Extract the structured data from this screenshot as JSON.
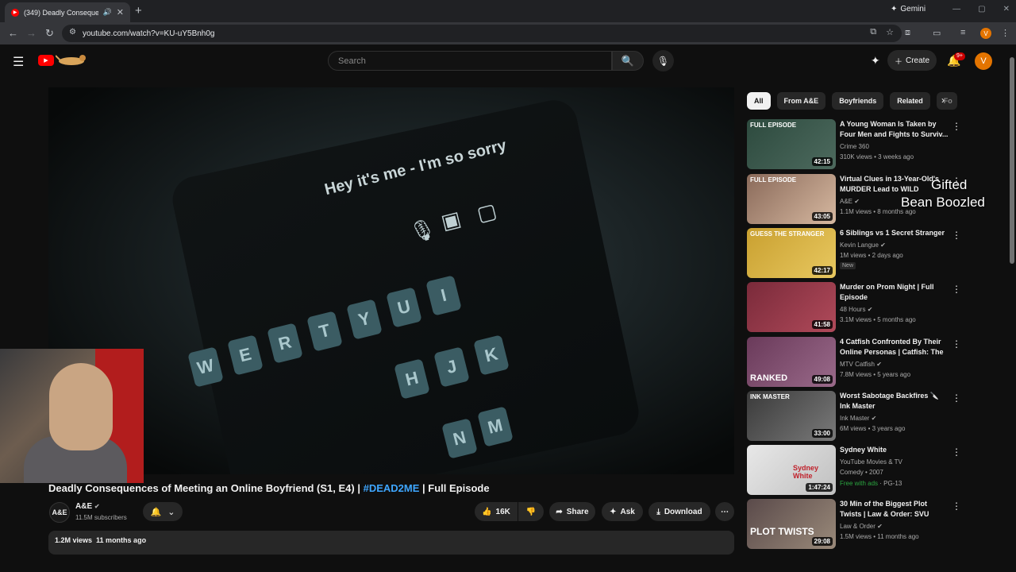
{
  "browser": {
    "tab_title": "(349) Deadly Consequence",
    "url": "youtube.com/watch?v=KU-uY5Bnh0g",
    "gemini_label": "Gemini",
    "profile_initial": "V"
  },
  "header": {
    "search_placeholder": "Search",
    "create_label": "Create",
    "notifications_badge": "9+",
    "avatar_initial": "V"
  },
  "video": {
    "screen_text": "Hey it's me - I'm so sorry",
    "keys": [
      "W",
      "E",
      "R",
      "T",
      "Y",
      "U",
      "I",
      "H",
      "J",
      "K",
      "N",
      "M"
    ],
    "title_main": "Deadly Consequences of Meeting an Online Boyfriend (S1, E4) | ",
    "title_tag": "#DEAD2ME",
    "title_end": " | Full Episode",
    "channel_logo": "A&E",
    "channel_name": "A&E",
    "subscribers": "11.5M subscribers",
    "likes": "16K",
    "share_label": "Share",
    "ask_label": "Ask",
    "download_label": "Download",
    "views": "1.2M views",
    "age": "11 months ago"
  },
  "chips": [
    "All",
    "From A&E",
    "Boyfriends",
    "Related",
    "Fo"
  ],
  "recommendations": [
    {
      "title": "A Young Woman Is Taken by Four Men and Fights to Surviv...",
      "channel": "Crime 360",
      "meta": "310K views • 3 weeks ago",
      "duration": "42:15",
      "label": "FULL EPISODE",
      "verified": false,
      "color": "#2d4a3e"
    },
    {
      "title": "Virtual Clues in 13-Year-Old's MURDER Lead to WILD Arrests...",
      "channel": "A&E",
      "meta": "1.1M views • 8 months ago",
      "duration": "43:05",
      "label": "FULL EPISODE",
      "verified": true,
      "color": "#8a6a5a"
    },
    {
      "title": "6 Siblings vs 1 Secret Stranger",
      "channel": "Kevin Langue",
      "meta": "1M views • 2 days ago",
      "duration": "42:17",
      "label": "GUESS THE STRANGER",
      "verified": true,
      "badge": "New",
      "color": "#c9a030"
    },
    {
      "title": "Murder on Prom Night | Full Episode",
      "channel": "48 Hours",
      "meta": "3.1M views • 5 months ago",
      "duration": "41:58",
      "label": "",
      "verified": true,
      "color": "#7a2a3a"
    },
    {
      "title": "4 Catfish Confronted By Their Online Personas | Catfish: The ...",
      "channel": "MTV Catfish",
      "meta": "7.8M views • 5 years ago",
      "duration": "49:08",
      "label": "RANKED",
      "verified": true,
      "color": "#6a3a5a"
    },
    {
      "title": "Worst Sabotage Backfires 🔪 Ink Master",
      "channel": "Ink Master",
      "meta": "6M views • 3 years ago",
      "duration": "33:00",
      "label": "INK MASTER",
      "verified": true,
      "color": "#4a4a4a"
    },
    {
      "title": "Sydney White",
      "channel": "YouTube Movies & TV",
      "meta": "Comedy • 2007",
      "duration": "1:47:24",
      "label": "Sydney White",
      "verified": false,
      "free": "Free with ads",
      "rating": "PG-13",
      "color": "#d8d8d8"
    },
    {
      "title": "30 Min of the Biggest Plot Twists | Law & Order: SVU",
      "channel": "Law & Order",
      "meta": "1.5M views • 11 months ago",
      "duration": "29:08",
      "label": "PLOT TWISTS",
      "verified": true,
      "color": "#5a4a4a"
    }
  ],
  "overlay": {
    "line1": "Gifted",
    "line2": "Bean Boozled"
  }
}
